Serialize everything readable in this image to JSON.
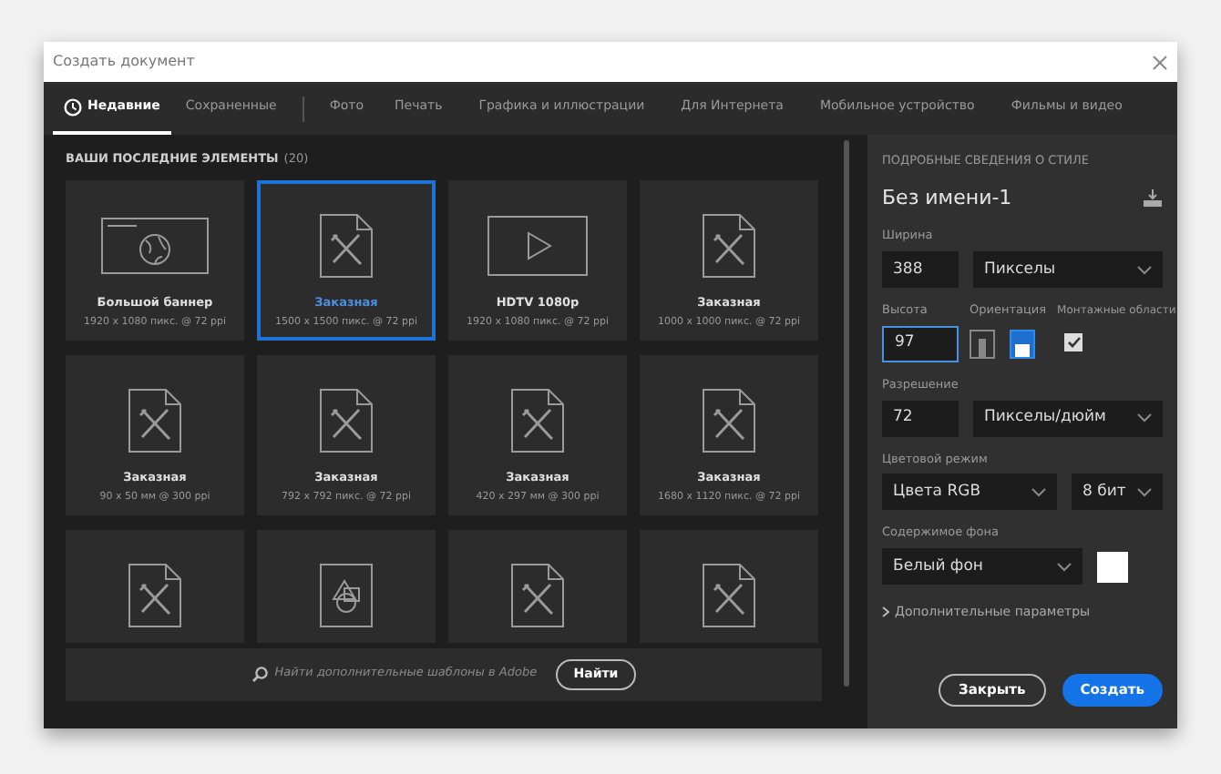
{
  "window": {
    "title": "Создать документ"
  },
  "tabs": [
    {
      "label": "Недавние",
      "selected": true
    },
    {
      "label": "Сохраненные",
      "selected": false
    },
    {
      "label": "Фото",
      "selected": false
    },
    {
      "label": "Печать",
      "selected": false
    },
    {
      "label": "Графика и иллюстрации",
      "selected": false
    },
    {
      "label": "Для Интернета",
      "selected": false
    },
    {
      "label": "Мобильное устройство",
      "selected": false
    },
    {
      "label": "Фильмы и видео",
      "selected": false
    }
  ],
  "recent": {
    "heading": "ВАШИ ПОСЛЕДНИЕ ЭЛЕМЕНТЫ",
    "count": "(20)",
    "items": [
      {
        "kind": "web",
        "name": "Большой баннер",
        "size": "1920 x 1080 пикс. @ 72 ppi",
        "selected": false
      },
      {
        "kind": "document",
        "name": "Заказная",
        "size": "1500 x 1500 пикс. @ 72 ppi",
        "selected": true
      },
      {
        "kind": "video",
        "name": "HDTV 1080p",
        "size": "1920 x 1080 пикс. @ 72 ppi",
        "selected": false
      },
      {
        "kind": "document",
        "name": "Заказная",
        "size": "1000 x 1000 пикс. @ 72 ppi",
        "selected": false
      },
      {
        "kind": "document",
        "name": "Заказная",
        "size": "90 x 50 мм @ 300 ppi",
        "selected": false
      },
      {
        "kind": "document",
        "name": "Заказная",
        "size": "792 x 792 пикс. @ 72 ppi",
        "selected": false
      },
      {
        "kind": "document",
        "name": "Заказная",
        "size": "420 x 297 мм @ 300 ppi",
        "selected": false
      },
      {
        "kind": "document",
        "name": "Заказная",
        "size": "1680 x 1120 пикс. @ 72 ppi",
        "selected": false
      },
      {
        "kind": "document",
        "selected": false
      },
      {
        "kind": "shapes",
        "selected": false
      },
      {
        "kind": "document",
        "selected": false
      },
      {
        "kind": "document",
        "selected": false
      }
    ]
  },
  "search": {
    "placeholder": "Найти дополнительные шаблоны в Adobe",
    "button": "Найти"
  },
  "details": {
    "heading": "ПОДРОБНЫЕ СВЕДЕНИЯ О СТИЛЕ",
    "name": "Без имени-1",
    "width": {
      "label": "Ширина",
      "value": "388",
      "unit": "Пикселы"
    },
    "height": {
      "label": "Высота",
      "value": "97",
      "focused": true
    },
    "orientation": {
      "label": "Ориентация",
      "options": [
        {
          "kind": "portrait",
          "selected": false
        },
        {
          "kind": "landscape",
          "selected": true
        }
      ]
    },
    "artboards": {
      "label": "Монтажные области",
      "checked": true
    },
    "resolution": {
      "label": "Разрешение",
      "value": "72",
      "unit": "Пикселы/дюйм"
    },
    "color_mode": {
      "label": "Цветовой режим",
      "value": "Цвета RGB",
      "depth": "8 бит"
    },
    "background": {
      "label": "Содержимое фона",
      "value": "Белый фон",
      "color": "#ffffff"
    },
    "advanced": "Дополнительные параметры",
    "buttons": {
      "close": "Закрыть",
      "create": "Создать"
    }
  }
}
